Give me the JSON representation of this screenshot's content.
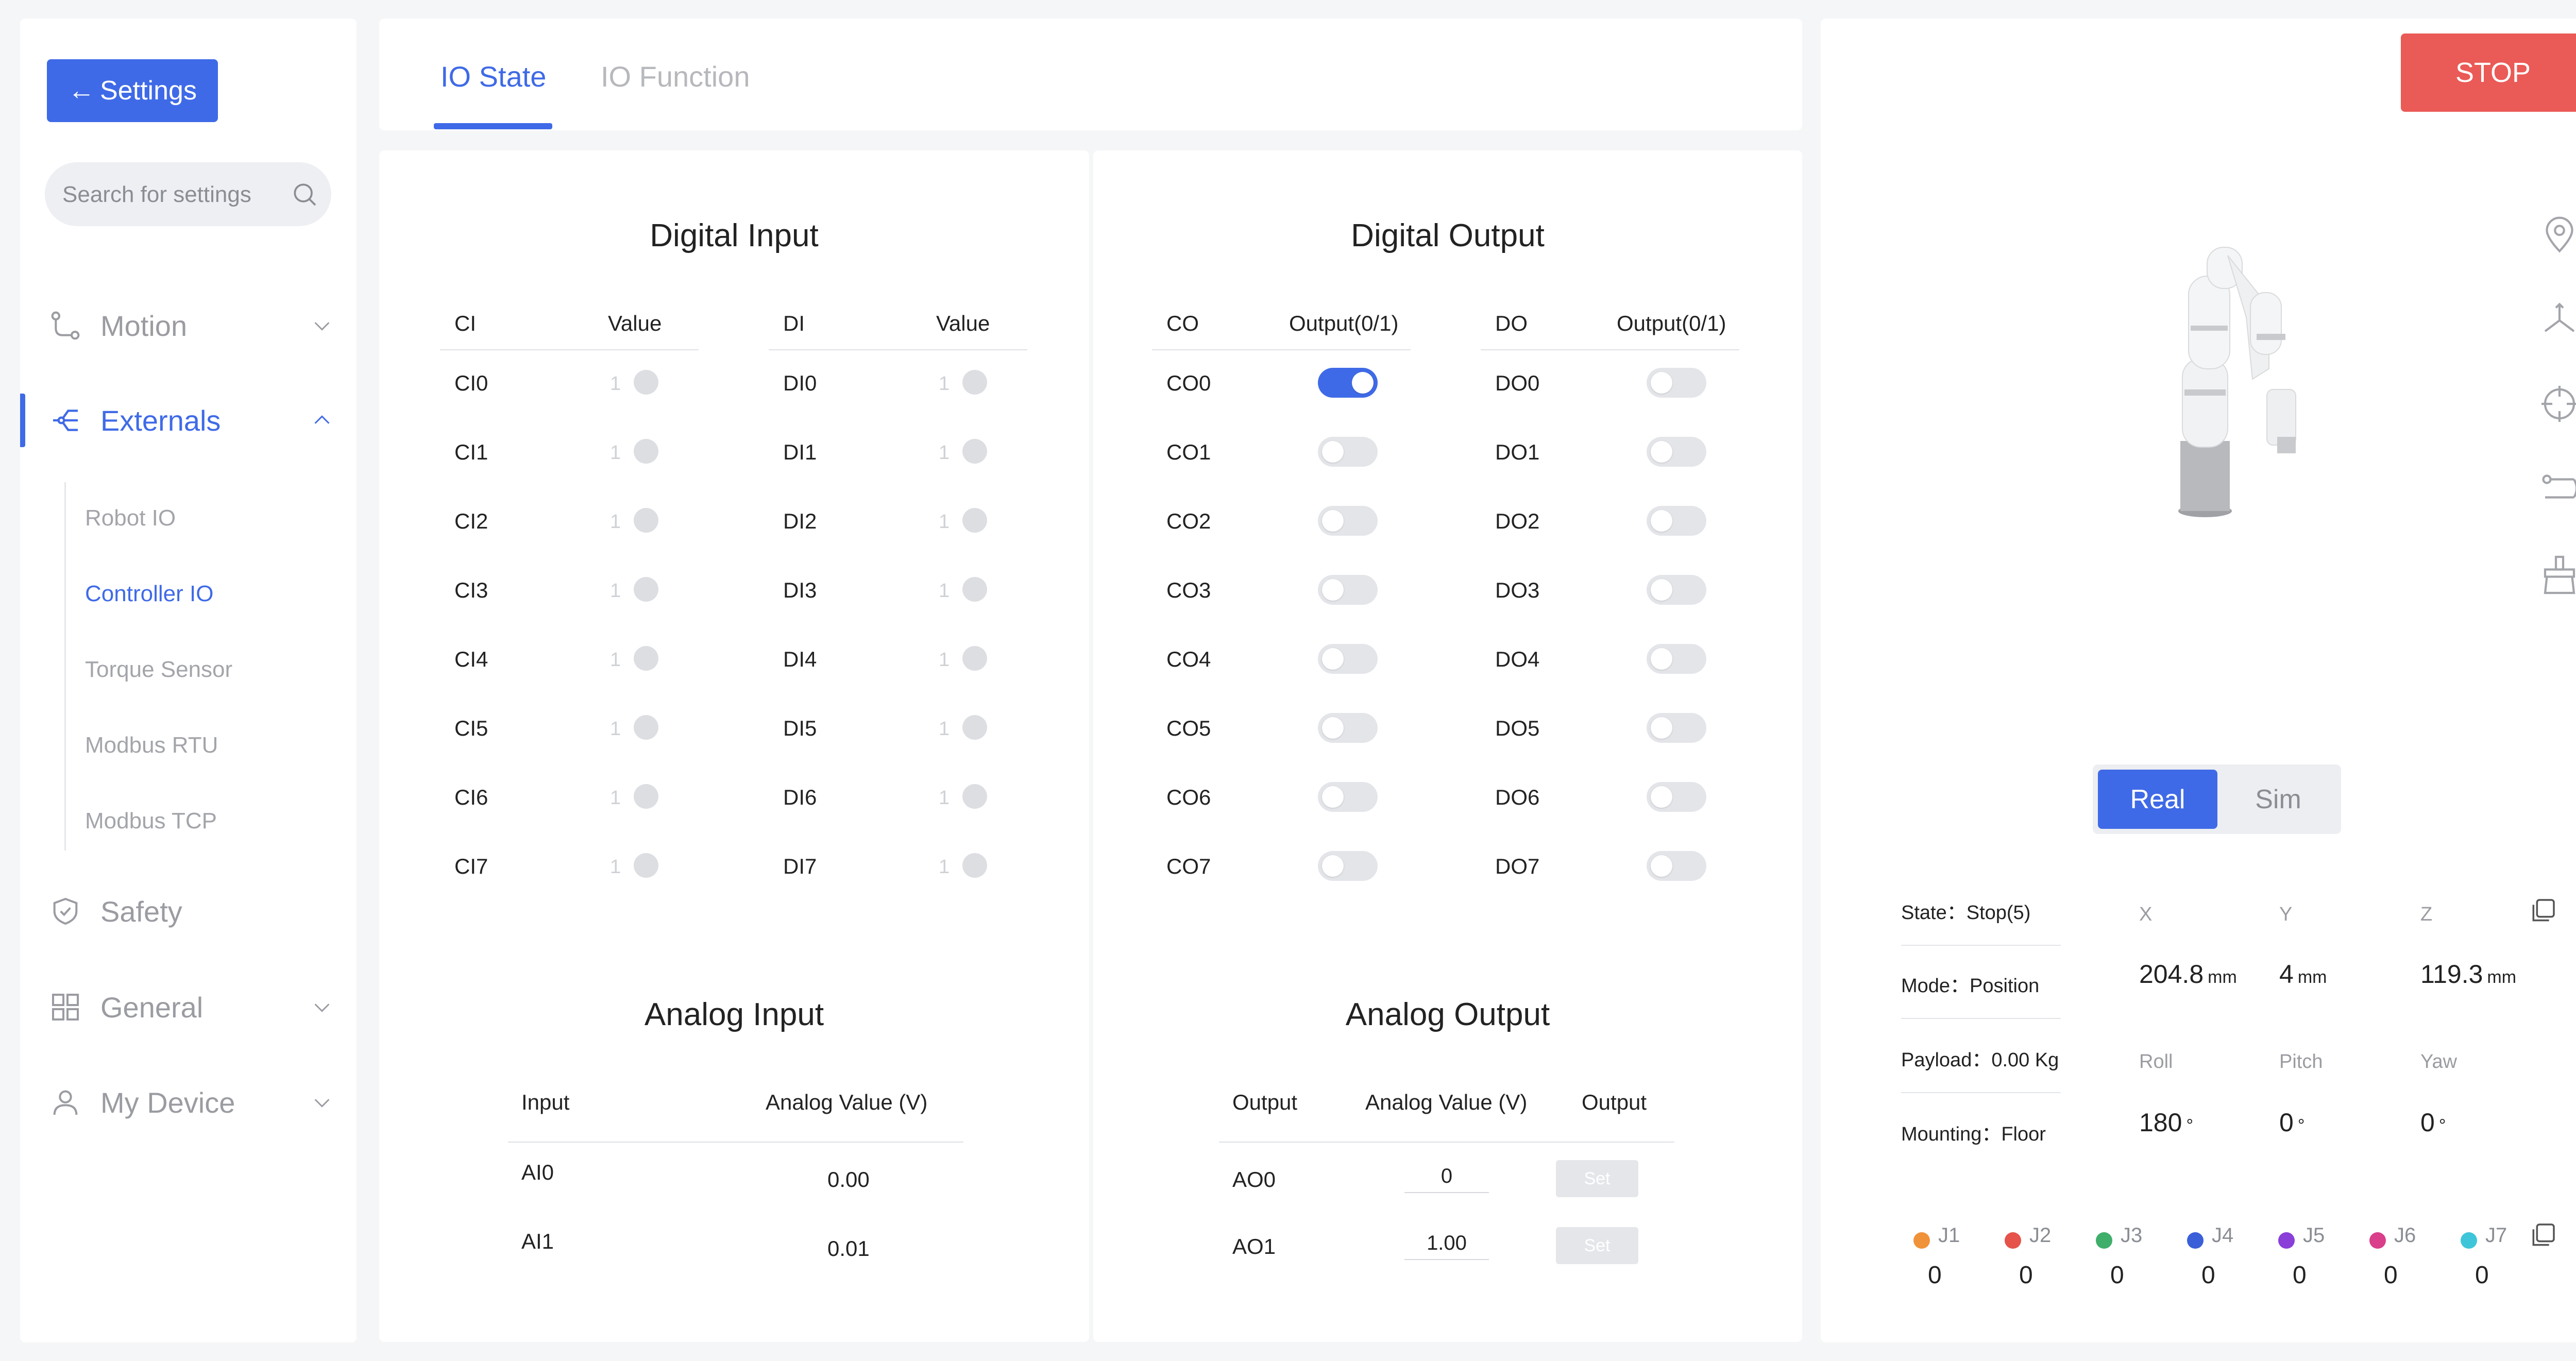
{
  "sidebar": {
    "back_label": "Settings",
    "search_placeholder": "Search for settings",
    "nav": [
      {
        "label": "Motion",
        "icon": "motion-icon"
      },
      {
        "label": "Externals",
        "icon": "externals-icon"
      },
      {
        "label": "Safety",
        "icon": "shield-icon"
      },
      {
        "label": "General",
        "icon": "grid-icon"
      },
      {
        "label": "My Device",
        "icon": "user-icon"
      }
    ],
    "subnav": [
      "Robot IO",
      "Controller IO",
      "Torque Sensor",
      "Modbus RTU",
      "Modbus TCP"
    ],
    "active_subnav": "Controller IO"
  },
  "tabs": [
    "IO State",
    "IO Function"
  ],
  "digital_input": {
    "title": "Digital Input",
    "ci_headers": [
      "CI",
      "Value"
    ],
    "di_headers": [
      "DI",
      "Value"
    ],
    "ci_rows": [
      "CI0",
      "CI1",
      "CI2",
      "CI3",
      "CI4",
      "CI5",
      "CI6",
      "CI7"
    ],
    "di_rows": [
      "DI0",
      "DI1",
      "DI2",
      "DI3",
      "DI4",
      "DI5",
      "DI6",
      "DI7"
    ],
    "value_text": "1"
  },
  "digital_output": {
    "title": "Digital Output",
    "co_headers": [
      "CO",
      "Output(0/1)"
    ],
    "do_headers": [
      "DO",
      "Output(0/1)"
    ],
    "co_rows": [
      "CO0",
      "CO1",
      "CO2",
      "CO3",
      "CO4",
      "CO5",
      "CO6",
      "CO7"
    ],
    "do_rows": [
      "DO0",
      "DO1",
      "DO2",
      "DO3",
      "DO4",
      "DO5",
      "DO6",
      "DO7"
    ],
    "co_states": [
      1,
      0,
      0,
      0,
      0,
      0,
      0,
      0
    ],
    "do_states": [
      0,
      0,
      0,
      0,
      0,
      0,
      0,
      0
    ]
  },
  "analog_input": {
    "title": "Analog Input",
    "headers": [
      "Input",
      "Analog Value (V)"
    ],
    "rows": [
      {
        "name": "AI0",
        "value": "0.00"
      },
      {
        "name": "AI1",
        "value": "0.01"
      }
    ]
  },
  "analog_output": {
    "title": "Analog Output",
    "headers": [
      "Output",
      "Analog Value (V)",
      "Output"
    ],
    "rows": [
      {
        "name": "AO0",
        "value": "0",
        "button": "Set"
      },
      {
        "name": "AO1",
        "value": "1.00",
        "button": "Set"
      }
    ]
  },
  "robot": {
    "stop_label": "STOP",
    "mode_real": "Real",
    "mode_sim": "Sim",
    "info": [
      "State：Stop(5)",
      "Mode：Position",
      "Payload：0.00 Kg",
      "Mounting：Floor"
    ],
    "coords": [
      {
        "label": "X",
        "value": "204.8",
        "unit": "mm"
      },
      {
        "label": "Y",
        "value": "4",
        "unit": "mm"
      },
      {
        "label": "Z",
        "value": "119.3",
        "unit": "mm"
      },
      {
        "label": "Roll",
        "value": "180",
        "unit": "°"
      },
      {
        "label": "Pitch",
        "value": "0",
        "unit": "°"
      },
      {
        "label": "Yaw",
        "value": "0",
        "unit": "°"
      }
    ],
    "joints": [
      {
        "name": "J1",
        "value": "0",
        "color": "#f0923a"
      },
      {
        "name": "J2",
        "value": "0",
        "color": "#e5534b"
      },
      {
        "name": "J3",
        "value": "0",
        "color": "#3fae6a"
      },
      {
        "name": "J4",
        "value": "0",
        "color": "#3a5fd9"
      },
      {
        "name": "J5",
        "value": "0",
        "color": "#8a3fd9"
      },
      {
        "name": "J6",
        "value": "0",
        "color": "#d93f8a"
      },
      {
        "name": "J7",
        "value": "0",
        "color": "#3fc5d9"
      }
    ]
  },
  "colors": {
    "accent": "#3f6ae7",
    "stop": "#ea5a56"
  }
}
